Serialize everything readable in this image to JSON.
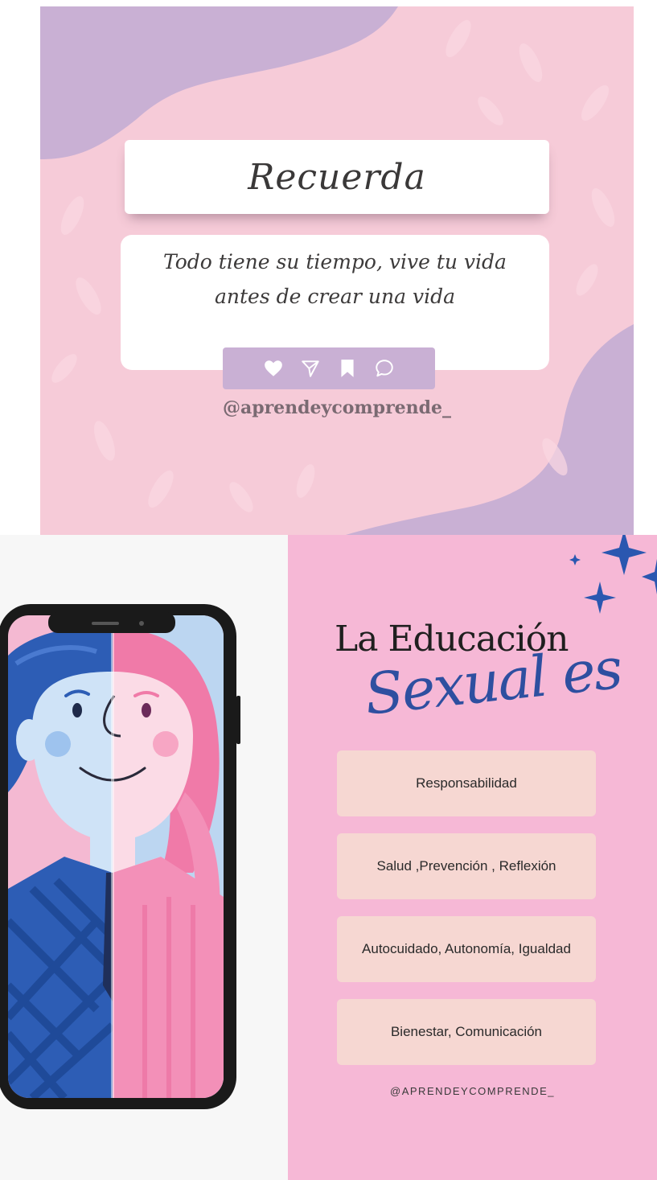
{
  "post_top": {
    "title": "Recuerda",
    "quote": "Todo tiene su tiempo, vive tu vida antes de crear una vida",
    "icons": [
      "heart-icon",
      "send-icon",
      "bookmark-icon",
      "comment-icon"
    ],
    "handle": "@aprendeycomprende_",
    "colors": {
      "background": "#f6cbd8",
      "blob": "#c9b0d4",
      "card": "#ffffff"
    }
  },
  "post_bottom": {
    "heading_line1": "La Educación",
    "heading_line2": "Sexual es",
    "items": [
      "Responsabilidad",
      "Salud ,Prevención , Reflexión",
      "Autocuidado, Autonomía, Igualdad",
      "Bienestar, Comunicación"
    ],
    "handle": "@APRENDEYCOMPRENDE_",
    "colors": {
      "panel": "#f6b8d6",
      "pill": "#f6d7d2",
      "script": "#2e4fa0",
      "sparkle": "#2a57b0"
    }
  }
}
